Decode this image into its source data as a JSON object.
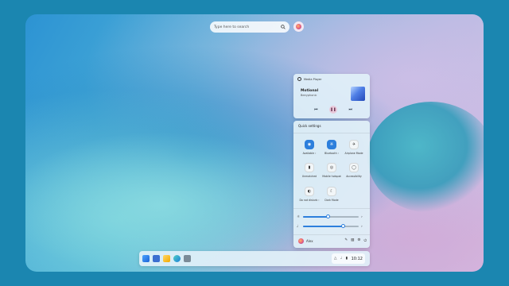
{
  "search": {
    "placeholder": "Type here to search"
  },
  "media_player": {
    "app_name": "Media Player",
    "song_title": "Motional",
    "artist": "Beeyphonic",
    "controls": {
      "prev_icon": "skip-previous-icon",
      "play_pause_icon": "pause-icon",
      "next_icon": "skip-next-icon"
    }
  },
  "quick_settings": {
    "title": "Quick settings",
    "tiles": [
      {
        "label": "Available",
        "icon": "wifi-icon",
        "active": true,
        "has_menu": true
      },
      {
        "label": "Bluetooth",
        "icon": "bluetooth-icon",
        "active": true,
        "has_menu": true
      },
      {
        "label": "Airplane Mode",
        "icon": "airplane-icon",
        "active": false,
        "has_menu": false
      },
      {
        "label": "Unmatched",
        "icon": "battery-saver-icon",
        "active": false,
        "has_menu": false
      },
      {
        "label": "Mobile hotspot",
        "icon": "hotspot-icon",
        "active": false,
        "has_menu": false
      },
      {
        "label": "Accessibility",
        "icon": "accessibility-icon",
        "active": false,
        "has_menu": false
      },
      {
        "label": "Do not disturb",
        "icon": "do-not-disturb-icon",
        "active": false,
        "has_menu": true
      },
      {
        "label": "Dark Mode",
        "icon": "dark-mode-icon",
        "active": false,
        "has_menu": false
      }
    ],
    "sliders": [
      {
        "name": "brightness",
        "icon": "brightness-icon",
        "level": 0.45
      },
      {
        "name": "volume",
        "icon": "volume-icon",
        "level": 0.72
      }
    ],
    "footer": {
      "user_name": "Alex"
    }
  },
  "taskbar": {
    "apps": [
      "start-icon",
      "widgets-icon",
      "file-explorer-icon",
      "browser-icon",
      "settings-icon"
    ],
    "clock": "10:12"
  },
  "colors": {
    "accent": "#2d7fdc",
    "panel": "#e1f0f8",
    "backdrop": "#1b86b0"
  }
}
